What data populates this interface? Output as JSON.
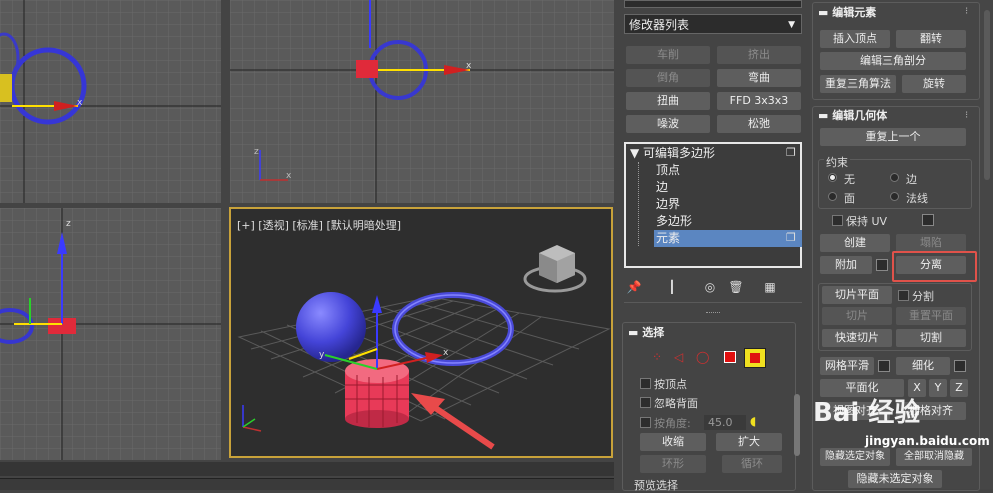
{
  "viewport": {
    "label": "[+] [透视] [标准] [默认明暗处理]"
  },
  "modifier_panel": {
    "modifier_list": "修改器列表",
    "buttons": [
      {
        "label": "车削",
        "enabled": false
      },
      {
        "label": "挤出",
        "enabled": false
      },
      {
        "label": "倒角",
        "enabled": false
      },
      {
        "label": "弯曲",
        "enabled": true
      },
      {
        "label": "扭曲",
        "enabled": true
      },
      {
        "label": "FFD 3x3x3",
        "enabled": true
      },
      {
        "label": "噪波",
        "enabled": true
      },
      {
        "label": "松弛",
        "enabled": true
      }
    ],
    "stack": {
      "root": "可编辑多边形",
      "items": [
        "顶点",
        "边",
        "边界",
        "多边形",
        "元素"
      ],
      "selected": "元素"
    },
    "selection": {
      "header": "选择",
      "by_vertex": "按顶点",
      "ignore_backfacing": "忽略背面",
      "by_angle": "按角度:",
      "angle_value": "45.0",
      "shrink": "收缩",
      "grow": "扩大",
      "ring": "环形",
      "loop": "循环",
      "preview": "预览选择"
    }
  },
  "edit_panel": {
    "edit_elements": {
      "header": "编辑元素",
      "insert_vertex": "插入顶点",
      "flip": "翻转",
      "edit_tri": "编辑三角剖分",
      "retriangulate": "重复三角算法",
      "turn": "旋转"
    },
    "edit_geometry": {
      "header": "编辑几何体",
      "repeat_last": "重复上一个",
      "constraints_label": "约束",
      "constraint_none": "无",
      "constraint_edge": "边",
      "constraint_face": "面",
      "constraint_normal": "法线",
      "preserve_uv": "保持 UV",
      "create": "创建",
      "collapse": "塌陷",
      "attach": "附加",
      "detach": "分离",
      "slice_plane": "切片平面",
      "split": "分割",
      "slice": "切片",
      "reset_plane": "重置平面",
      "quickslice": "快速切片",
      "cut": "切割",
      "meshsmooth": "网格平滑",
      "tessellate": "细化",
      "make_planar": "平面化",
      "x": "X",
      "y": "Y",
      "z": "Z",
      "view_align": "视图对齐",
      "grid_align": "栅格对齐",
      "hide_selected": "隐藏选定对象",
      "unhide_all": "全部取消隐藏",
      "hide_unselected": "隐藏未选定对象"
    }
  },
  "watermark": {
    "text": "Bai 经验",
    "url": "jingyan.baidu.com"
  },
  "colors": {
    "accent_highlight": "#e0524a",
    "viewport_border": "#c8a23a",
    "stack_selected": "#5b86c1"
  }
}
